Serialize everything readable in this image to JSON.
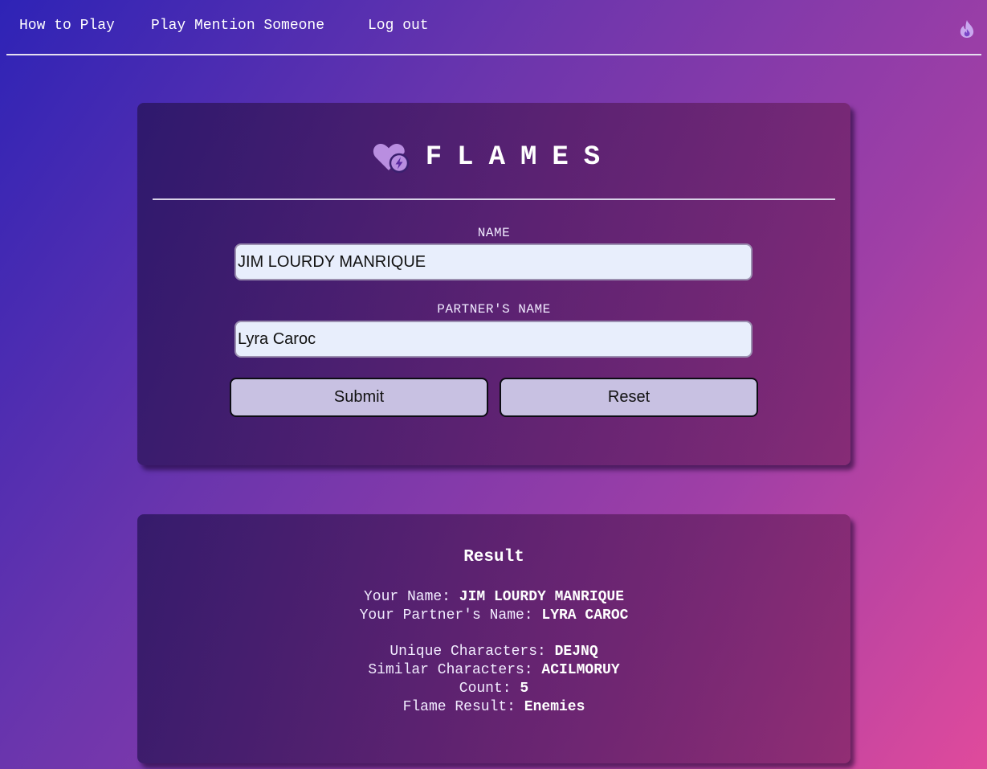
{
  "nav": {
    "how_to_play": "How to Play",
    "play_mention": "Play Mention Someone",
    "logout": "Log out",
    "right_icon": "flame-icon"
  },
  "brand": {
    "icon": "heart-bolt-icon",
    "title": "FLAMES"
  },
  "form": {
    "name_label": "NAME",
    "name_value": "JIM LOURDY MANRIQUE",
    "partner_label": "PARTNER'S NAME",
    "partner_value": "Lyra Caroc",
    "submit_label": "Submit",
    "reset_label": "Reset"
  },
  "result": {
    "title": "Result",
    "your_name_label": "Your Name: ",
    "your_name_value": "JIM LOURDY MANRIQUE",
    "partner_name_label": "Your Partner's Name: ",
    "partner_name_value": "LYRA CAROC",
    "unique_label": "Unique Characters: ",
    "unique_value": "DEJNQ",
    "similar_label": "Similar Characters: ",
    "similar_value": "ACILMORUY",
    "count_label": "Count: ",
    "count_value": "5",
    "flame_label": "Flame Result: ",
    "flame_value": "Enemies"
  },
  "colors": {
    "icon_purple": "#b98ee0",
    "bolt_purple": "#5b2ba0",
    "input_bg": "#e8eefc",
    "button_bg": "#c8c1e2"
  }
}
